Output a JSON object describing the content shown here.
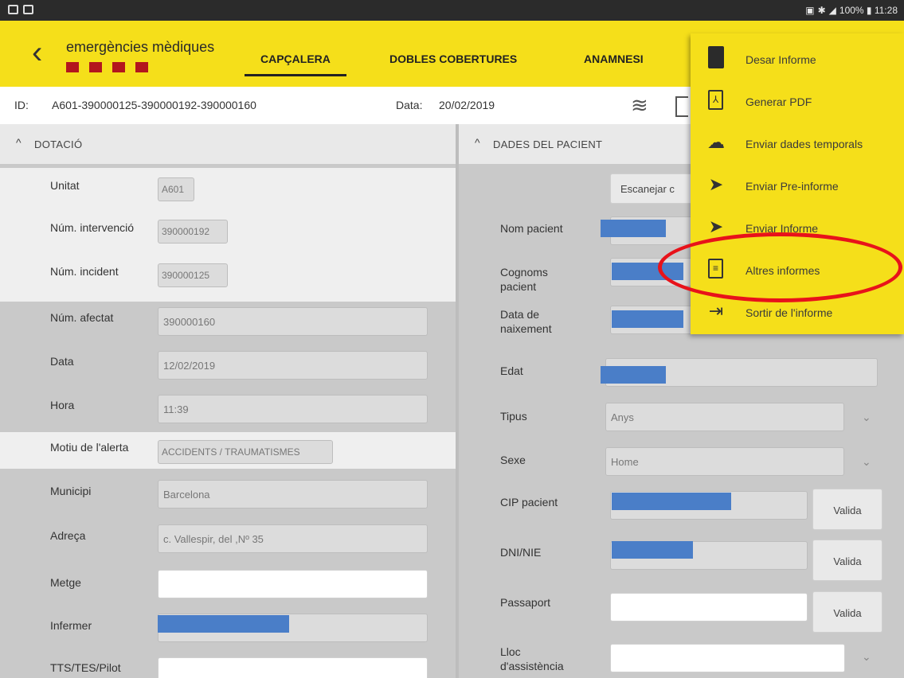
{
  "status_bar": {
    "right_text": "100% ▮ 11:28"
  },
  "header": {
    "logo_text": "emergències mèdiques",
    "tabs": [
      {
        "label": "CAPÇALERA",
        "active": true
      },
      {
        "label": "DOBLES COBERTURES",
        "active": false
      },
      {
        "label": "ANAMNESI",
        "active": false
      }
    ]
  },
  "info": {
    "id_label": "ID:",
    "id_value": "A601-390000125-390000192-390000160",
    "date_label": "Data:",
    "date_value": "20/02/2019"
  },
  "dotacio": {
    "title": "DOTACIÓ",
    "fields": [
      {
        "label": "Unitat",
        "value": "A601"
      },
      {
        "label": "Núm. intervenció",
        "value": "390000192"
      },
      {
        "label": "Núm. incident",
        "value": "390000125"
      },
      {
        "label": "Núm. afectat",
        "value": "390000160"
      },
      {
        "label": "Data",
        "value": "12/02/2019"
      },
      {
        "label": "Hora",
        "value": "11:39"
      },
      {
        "label": "Motiu de l'alerta",
        "value": "ACCIDENTS / TRAUMATISMES"
      },
      {
        "label": "Municipi",
        "value": "Barcelona"
      },
      {
        "label": "Adreça",
        "value": "c. Vallespir, del ,Nº 35"
      },
      {
        "label": "Metge",
        "value": ""
      },
      {
        "label": "Infermer",
        "value": ""
      },
      {
        "label": "TTS/TES/Pilot",
        "value": ""
      }
    ]
  },
  "pacient": {
    "title": "DADES DEL PACIENT",
    "scan_button": "Escanejar c",
    "fields": [
      {
        "label": "Nom pacient"
      },
      {
        "label": "Cognoms pacient"
      },
      {
        "label": "Data de naixement"
      },
      {
        "label": "Edat"
      },
      {
        "label": "Tipus",
        "value": "Anys"
      },
      {
        "label": "Sexe",
        "value": "Home"
      },
      {
        "label": "CIP pacient"
      },
      {
        "label": "DNI/NIE"
      },
      {
        "label": "Passaport"
      },
      {
        "label": "Lloc d'assistència"
      }
    ],
    "valida_label": "Valida"
  },
  "menu": {
    "items": [
      {
        "label": "Desar Informe",
        "icon": "sd-card-icon"
      },
      {
        "label": "Generar PDF",
        "icon": "pdf-icon"
      },
      {
        "label": "Enviar dades temporals",
        "icon": "cloud-upload-icon"
      },
      {
        "label": "Enviar Pre-informe",
        "icon": "send-icon"
      },
      {
        "label": "Enviar Informe",
        "icon": "send-icon"
      },
      {
        "label": "Altres informes",
        "icon": "document-icon"
      },
      {
        "label": "Sortir de l'informe",
        "icon": "exit-icon"
      }
    ]
  },
  "colors": {
    "brand_yellow": "#f5df1a",
    "logo_red": "#b3161d",
    "highlight_red": "#e8121a",
    "redaction_blue": "#4a7ec8"
  }
}
